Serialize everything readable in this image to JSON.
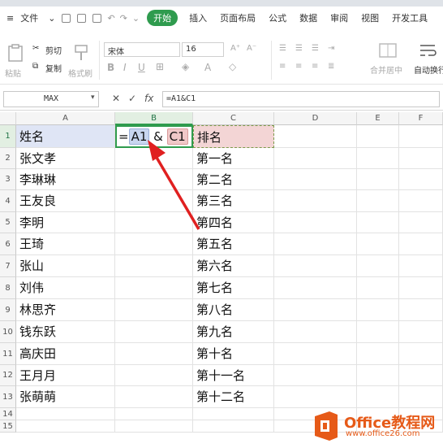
{
  "menu": {
    "file": "文件",
    "home": "开始",
    "insert": "插入",
    "page_layout": "页面布局",
    "formulas": "公式",
    "data": "数据",
    "review": "审阅",
    "view": "视图",
    "developer": "开发工具"
  },
  "toolbar": {
    "paste": "粘贴",
    "cut": "剪切",
    "copy": "复制",
    "format_painter": "格式刷",
    "font_name": "宋体",
    "font_size": "16",
    "merge_center": "合并居中",
    "wrap_text": "自动换行"
  },
  "formula_bar": {
    "name_box": "MAX",
    "fx": "fx",
    "formula": "=A1&C1"
  },
  "columns": [
    "A",
    "B",
    "C",
    "D",
    "E",
    "F"
  ],
  "rows": [
    "1",
    "2",
    "3",
    "4",
    "5",
    "6",
    "7",
    "8",
    "9",
    "10",
    "11",
    "12",
    "13",
    "14",
    "15"
  ],
  "cells": {
    "A": [
      "姓名",
      "张文孝",
      "李琳琳",
      "王友良",
      "李明",
      "王琦",
      "张山",
      "刘伟",
      "林思齐",
      "钱东跃",
      "高庆田",
      "王月月",
      "张萌萌"
    ],
    "C": [
      "排名",
      "第一名",
      "第二名",
      "第三名",
      "第四名",
      "第五名",
      "第六名",
      "第七名",
      "第八名",
      "第九名",
      "第十名",
      "第十一名",
      "第十二名"
    ]
  },
  "edit_cell": {
    "eq": "=",
    "ref1": "A1",
    "amp": "&",
    "ref2": "C1"
  },
  "logo": {
    "title": "Office教程网",
    "url": "www.office26.com"
  },
  "colors": {
    "accent": "#2f9b4e",
    "arrow": "#e02020",
    "logo": "#e65a18"
  }
}
